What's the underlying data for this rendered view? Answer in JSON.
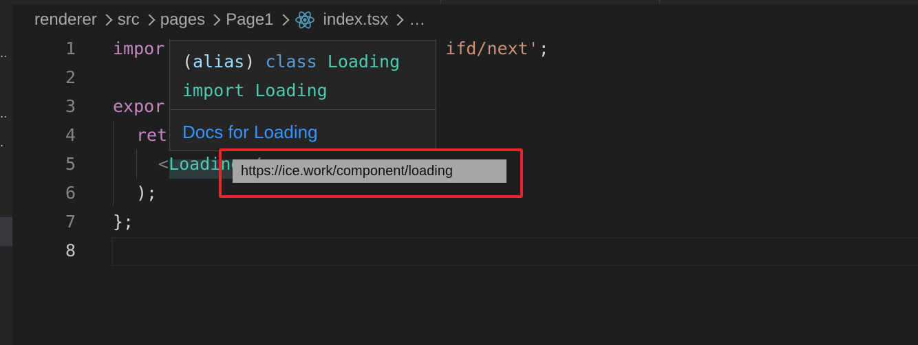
{
  "breadcrumb": {
    "items": [
      "renderer",
      "src",
      "pages",
      "Page1"
    ],
    "file": "index.tsx",
    "file_icon": "react-icon",
    "trailing": "…"
  },
  "editor": {
    "line_numbers": [
      "1",
      "2",
      "3",
      "4",
      "5",
      "6",
      "7",
      "8"
    ],
    "active_line": "8",
    "lines": {
      "l1_kw": "impor",
      "l1_str": "ifd/next'",
      "l1_end": ";",
      "l3_kw": "expor",
      "l4_kw": "ret",
      "l5_open": "<",
      "l5_tag": "Loading",
      "l5_close": " />",
      "l6": ");",
      "l7": "};"
    }
  },
  "hover": {
    "paren_open": "(",
    "alias": "alias",
    "paren_close": ")",
    "kw_class": "class",
    "class_name": "Loading",
    "kw_import": "import",
    "import_name": "Loading",
    "docs_link": "Docs for Loading"
  },
  "tooltip": {
    "url": "https://ice.work/component/loading"
  },
  "colors": {
    "background": "#1e1e1e",
    "link": "#3794ff",
    "highlight_box": "#e8262b"
  }
}
